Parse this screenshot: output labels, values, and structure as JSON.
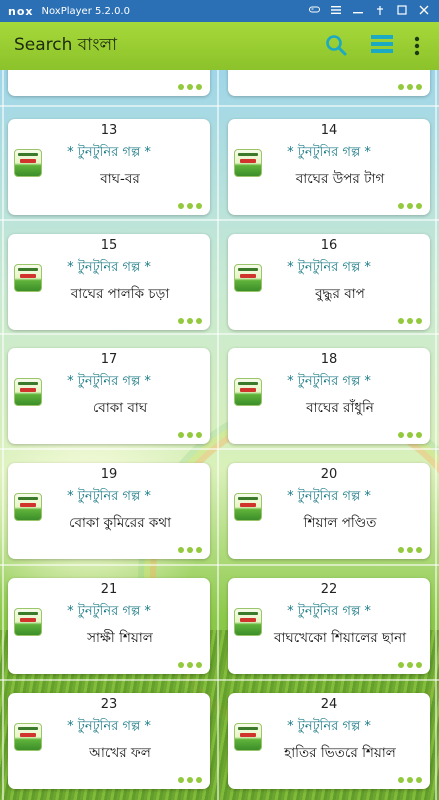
{
  "window": {
    "logo": "nox",
    "title": "NoxPlayer 5.2.0.0"
  },
  "appbar": {
    "title": "Search  বাংলা"
  },
  "cards": [
    {
      "num": "",
      "category": "",
      "title": ""
    },
    {
      "num": "",
      "category": "",
      "title": ""
    },
    {
      "num": "13",
      "category": "* টুনটুনির গল্প *",
      "title": "বাঘ-বর"
    },
    {
      "num": "14",
      "category": "* টুনটুনির গল্প *",
      "title": "বাঘের উপর টাগ"
    },
    {
      "num": "15",
      "category": "* টুনটুনির গল্প *",
      "title": "বাঘের পালকি চড়া"
    },
    {
      "num": "16",
      "category": "* টুনটুনির গল্প *",
      "title": "বুদ্ধুর বাপ"
    },
    {
      "num": "17",
      "category": "* টুনটুনির গল্প *",
      "title": "বোকা বাঘ"
    },
    {
      "num": "18",
      "category": "* টুনটুনির গল্প *",
      "title": "বাঘের রাঁধুনি"
    },
    {
      "num": "19",
      "category": "* টুনটুনির গল্প *",
      "title": "বোকা কুমিরের কথা"
    },
    {
      "num": "20",
      "category": "* টুনটুনির গল্প *",
      "title": "শিয়াল পণ্ডিত"
    },
    {
      "num": "21",
      "category": "* টুনটুনির গল্প *",
      "title": "সাক্ষী শিয়াল"
    },
    {
      "num": "22",
      "category": "* টুনটুনির গল্প *",
      "title": "বাঘখেকো শিয়ালের ছানা"
    },
    {
      "num": "23",
      "category": "* টুনটুনির গল্প *",
      "title": "আখের ফল"
    },
    {
      "num": "24",
      "category": "* টুনটুনির গল্প *",
      "title": "হাতির ভিতরে শিয়াল"
    }
  ],
  "colors": {
    "appbar": "#9ccf33",
    "accent": "#1ba9c4",
    "titlebar": "#2b6fb4",
    "dots": "#93c93d"
  }
}
